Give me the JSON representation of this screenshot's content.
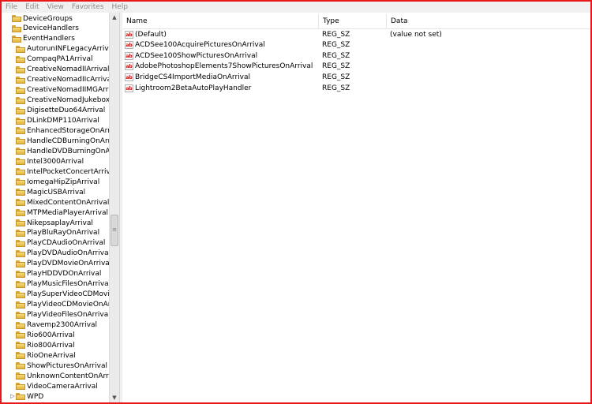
{
  "menu": [
    "File",
    "Edit",
    "View",
    "Favorites",
    "Help"
  ],
  "tree": {
    "items": [
      {
        "label": "DeviceGroups",
        "level": 0
      },
      {
        "label": "DeviceHandlers",
        "level": 0
      },
      {
        "label": "EventHandlers",
        "level": 0
      },
      {
        "label": "AutorunINFLegacyArrival",
        "level": 1
      },
      {
        "label": "CompaqPA1Arrival",
        "level": 1
      },
      {
        "label": "CreativeNomadIIArrival",
        "level": 1
      },
      {
        "label": "CreativeNomadIIcArrival",
        "level": 1
      },
      {
        "label": "CreativeNomadIIMGArrival",
        "level": 1
      },
      {
        "label": "CreativeNomadJukeboxArrival",
        "level": 1
      },
      {
        "label": "DigisetteDuo64Arrival",
        "level": 1
      },
      {
        "label": "DLinkDMP110Arrival",
        "level": 1
      },
      {
        "label": "EnhancedStorageOnArrival",
        "level": 1
      },
      {
        "label": "HandleCDBurningOnArrival",
        "level": 1
      },
      {
        "label": "HandleDVDBurningOnArrival",
        "level": 1
      },
      {
        "label": "Intel3000Arrival",
        "level": 1
      },
      {
        "label": "IntelPocketConcertArrival",
        "level": 1
      },
      {
        "label": "IomegaHipZipArrival",
        "level": 1
      },
      {
        "label": "MagicUSBArrival",
        "level": 1
      },
      {
        "label": "MixedContentOnArrival",
        "level": 1
      },
      {
        "label": "MTPMediaPlayerArrival",
        "level": 1
      },
      {
        "label": "NikepsaplayArrival",
        "level": 1
      },
      {
        "label": "PlayBluRayOnArrival",
        "level": 1
      },
      {
        "label": "PlayCDAudioOnArrival",
        "level": 1
      },
      {
        "label": "PlayDVDAudioOnArrival",
        "level": 1
      },
      {
        "label": "PlayDVDMovieOnArrival",
        "level": 1
      },
      {
        "label": "PlayHDDVDOnArrival",
        "level": 1
      },
      {
        "label": "PlayMusicFilesOnArrival",
        "level": 1
      },
      {
        "label": "PlaySuperVideoCDMovieOnArrival",
        "level": 1
      },
      {
        "label": "PlayVideoCDMovieOnArrival",
        "level": 1
      },
      {
        "label": "PlayVideoFilesOnArrival",
        "level": 1
      },
      {
        "label": "Ravemp2300Arrival",
        "level": 1
      },
      {
        "label": "Rio600Arrival",
        "level": 1
      },
      {
        "label": "Rio800Arrival",
        "level": 1
      },
      {
        "label": "RioOneArrival",
        "level": 1
      },
      {
        "label": "ShowPicturesOnArrival",
        "level": 1
      },
      {
        "label": "UnknownContentOnArrival",
        "level": 1
      },
      {
        "label": "VideoCameraArrival",
        "level": 1
      },
      {
        "label": "WPD",
        "level": 1
      }
    ]
  },
  "list": {
    "columns": [
      "Name",
      "Type",
      "Data"
    ],
    "rows": [
      {
        "name": "(Default)",
        "type": "REG_SZ",
        "data": "(value not set)"
      },
      {
        "name": "ACDSee100AcquirePicturesOnArrival",
        "type": "REG_SZ",
        "data": ""
      },
      {
        "name": "ACDSee100ShowPicturesOnArrival",
        "type": "REG_SZ",
        "data": ""
      },
      {
        "name": "AdobePhotoshopElements7ShowPicturesOnArrival",
        "type": "REG_SZ",
        "data": ""
      },
      {
        "name": "BridgeCS4ImportMediaOnArrival",
        "type": "REG_SZ",
        "data": ""
      },
      {
        "name": "Lightroom2BetaAutoPlayHandler",
        "type": "REG_SZ",
        "data": ""
      }
    ]
  },
  "icons": {
    "value": "ab-string-icon",
    "folder": "folder-icon"
  },
  "colors": {
    "frame": "#e81818",
    "folder": "#e2b43d"
  }
}
